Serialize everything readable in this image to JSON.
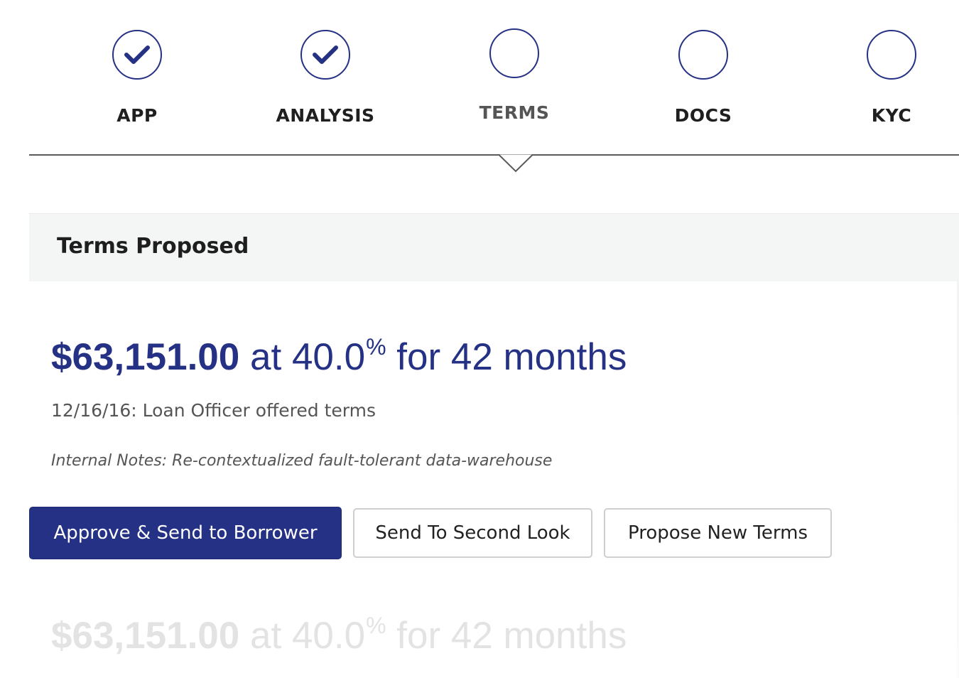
{
  "stepper": {
    "steps": [
      {
        "label": "APP",
        "status": "complete",
        "icon": "check-icon"
      },
      {
        "label": "ANALYSIS",
        "status": "complete",
        "icon": "check-icon"
      },
      {
        "label": "TERMS",
        "status": "current",
        "icon": "empty-circle-icon"
      },
      {
        "label": "DOCS",
        "status": "pending",
        "icon": "empty-circle-icon"
      },
      {
        "label": "KYC",
        "status": "pending",
        "icon": "empty-circle-icon"
      }
    ]
  },
  "panel": {
    "title": "Terms Proposed"
  },
  "offer": {
    "amount": "$63,151.00",
    "at_text": "at",
    "rate": "40.0",
    "rate_symbol": "%",
    "term_text": "for 42 months",
    "meta": "12/16/16: Loan Officer offered terms",
    "notes": "Internal Notes: Re-contextualized fault-tolerant data-warehouse"
  },
  "actions": {
    "approve_label": "Approve & Send to Borrower",
    "second_look_label": "Send To Second Look",
    "propose_label": "Propose New Terms"
  },
  "previous_offer": {
    "amount": "$63,151.00",
    "at_text": "at",
    "rate": "40.0",
    "rate_symbol": "%",
    "term_text": "for 42 months"
  },
  "colors": {
    "brand_navy": "#253184",
    "faded_text": "#e3e3e3",
    "panel_bg": "#f4f5f5"
  }
}
